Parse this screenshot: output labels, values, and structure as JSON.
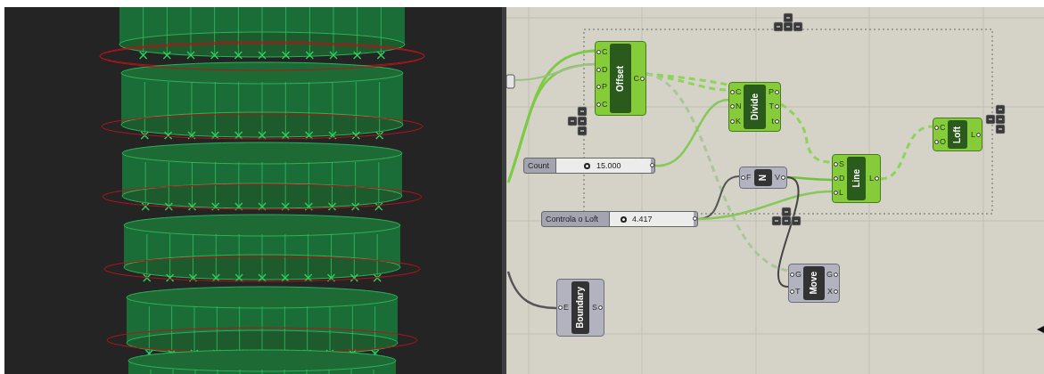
{
  "canvas": {
    "components": [
      {
        "name": "Offset",
        "selected": true,
        "inputs": [
          "C",
          "D",
          "P",
          "C"
        ],
        "outputs": [
          "C"
        ]
      },
      {
        "name": "Divide",
        "selected": true,
        "inputs": [
          "C",
          "N",
          "K"
        ],
        "outputs": [
          "P",
          "T",
          "t"
        ]
      },
      {
        "name": "Line",
        "selected": true,
        "inputs": [
          "S",
          "D",
          "L"
        ],
        "outputs": [
          "L"
        ]
      },
      {
        "name": "Loft",
        "selected": true,
        "inputs": [
          "C",
          "O"
        ],
        "outputs": [
          "L"
        ]
      },
      {
        "name": "N",
        "selected": false,
        "inputs": [
          "F"
        ],
        "outputs": [
          "V"
        ]
      },
      {
        "name": "Move",
        "selected": false,
        "inputs": [
          "G",
          "T"
        ],
        "outputs": [
          "G",
          "X"
        ]
      },
      {
        "name": "Boundary",
        "selected": false,
        "inputs": [
          "E"
        ],
        "outputs": [
          "S"
        ]
      }
    ],
    "sliders": [
      {
        "label": "Count",
        "value": "15.000",
        "level": 0.33
      },
      {
        "label": "Controla o Loft",
        "value": "4.417",
        "level": 0.16
      }
    ]
  }
}
